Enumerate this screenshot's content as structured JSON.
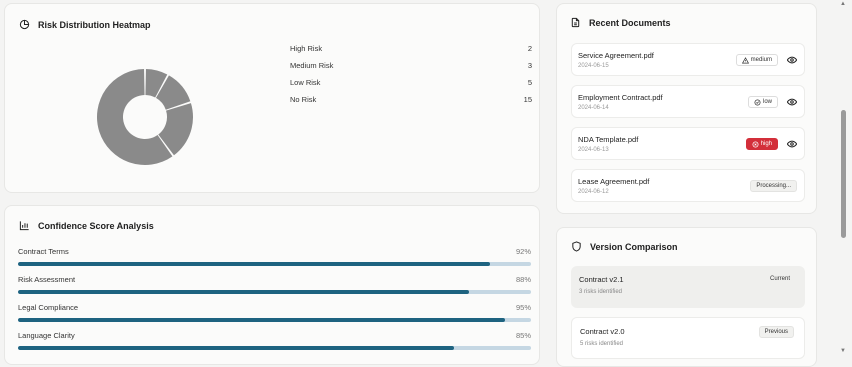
{
  "heatmap": {
    "title": "Risk Distribution Heatmap",
    "icon": "pie-chart-icon",
    "legend": [
      {
        "label": "High Risk",
        "value": "2"
      },
      {
        "label": "Medium Risk",
        "value": "3"
      },
      {
        "label": "Low Risk",
        "value": "5"
      },
      {
        "label": "No Risk",
        "value": "15"
      }
    ]
  },
  "chart_data": {
    "type": "pie",
    "categories": [
      "High Risk",
      "Medium Risk",
      "Low Risk",
      "No Risk"
    ],
    "values": [
      2,
      3,
      5,
      15
    ],
    "title": "Risk Distribution Heatmap",
    "slice_color": "#8a8a8a"
  },
  "confidence": {
    "title": "Confidence Score Analysis",
    "icon": "bar-chart-icon",
    "fill_color": "#1e6380",
    "track_color": "#c5d7e3",
    "rows": [
      {
        "label": "Contract Terms",
        "pct": "92%",
        "value": 92
      },
      {
        "label": "Risk Assessment",
        "pct": "88%",
        "value": 88
      },
      {
        "label": "Legal Compliance",
        "pct": "95%",
        "value": 95
      },
      {
        "label": "Language Clarity",
        "pct": "85%",
        "value": 85
      }
    ]
  },
  "recent": {
    "title": "Recent Documents",
    "icon": "document-icon",
    "docs": [
      {
        "name": "Service Agreement.pdf",
        "date": "2024-06-15",
        "badge": "medium",
        "badge_icon": "warning-triangle-icon",
        "viewable": true
      },
      {
        "name": "Employment Contract.pdf",
        "date": "2024-06-14",
        "badge": "low",
        "badge_icon": "check-circle-icon",
        "viewable": true
      },
      {
        "name": "NDA Template.pdf",
        "date": "2024-06-13",
        "badge": "high",
        "badge_icon": "x-circle-icon",
        "viewable": true
      },
      {
        "name": "Lease Agreement.pdf",
        "date": "2024-06-12",
        "badge": "Processing...",
        "badge_icon": "",
        "viewable": false
      }
    ]
  },
  "version": {
    "title": "Version Comparison",
    "icon": "shield-icon",
    "items": [
      {
        "name": "Contract v2.1",
        "sub": "3 risks identified",
        "tag": "Current"
      },
      {
        "name": "Contract v2.0",
        "sub": "5 risks identified",
        "tag": "Previous"
      }
    ]
  },
  "colors": {
    "high_badge": "#d32f3a",
    "accent": "#1e6380"
  }
}
